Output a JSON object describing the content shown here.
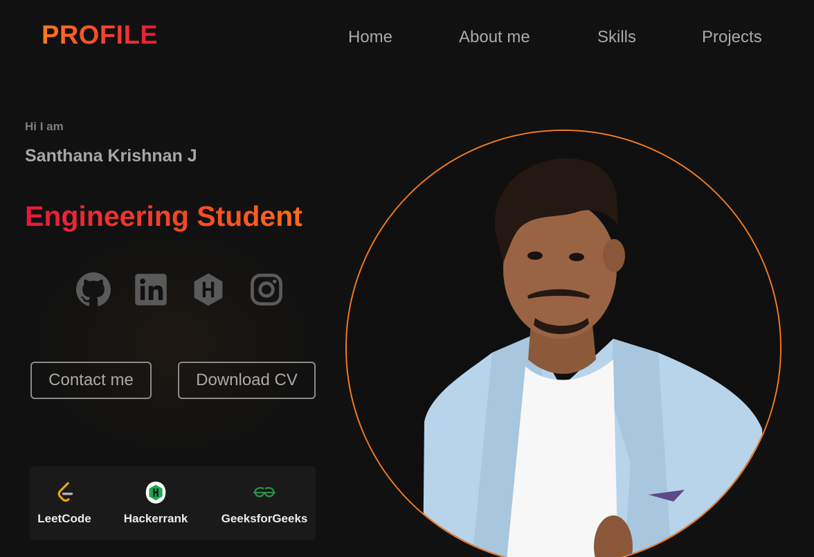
{
  "header": {
    "logo": "PROFILE",
    "nav": [
      "Home",
      "About me",
      "Skills",
      "Projects"
    ]
  },
  "hero": {
    "greeting": "Hi I am",
    "name": "Santhana Krishnan J",
    "role": "Engineering Student",
    "social_icons": [
      "github-icon",
      "linkedin-icon",
      "hashnode-icon",
      "instagram-icon"
    ],
    "buttons": {
      "contact": "Contact me",
      "download": "Download CV"
    }
  },
  "platforms": [
    {
      "label": "LeetCode",
      "icon": "leetcode-icon"
    },
    {
      "label": "Hackerrank",
      "icon": "hackerrank-icon"
    },
    {
      "label": "GeeksforGeeks",
      "icon": "geeksforgeeks-icon"
    }
  ],
  "colors": {
    "background": "#111111",
    "accent_orange": "#f47b20",
    "accent_red": "#e8173a",
    "nav_text": "#a9a9a9",
    "icon_gray": "#5a5a5a"
  }
}
